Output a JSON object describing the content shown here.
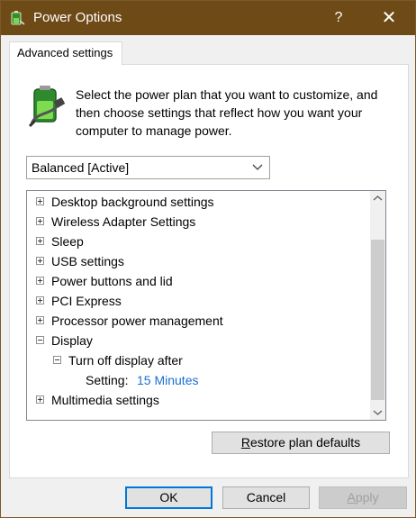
{
  "window": {
    "title": "Power Options",
    "help_glyph": "?",
    "close_glyph": "✕"
  },
  "tab": {
    "label": "Advanced settings"
  },
  "description": "Select the power plan that you want to customize, and then choose settings that reflect how you want your computer to manage power.",
  "plan_select": {
    "value": "Balanced [Active]"
  },
  "tree": {
    "items": [
      {
        "label": "Desktop background settings",
        "expanded": false
      },
      {
        "label": "Wireless Adapter Settings",
        "expanded": false
      },
      {
        "label": "Sleep",
        "expanded": false
      },
      {
        "label": "USB settings",
        "expanded": false
      },
      {
        "label": "Power buttons and lid",
        "expanded": false
      },
      {
        "label": "PCI Express",
        "expanded": false
      },
      {
        "label": "Processor power management",
        "expanded": false
      },
      {
        "label": "Display",
        "expanded": true
      },
      {
        "label": "Turn off display after",
        "expanded": true
      },
      {
        "label": "Setting:",
        "value": "15 Minutes"
      },
      {
        "label": "Multimedia settings",
        "expanded": false
      }
    ]
  },
  "buttons": {
    "restore_first": "R",
    "restore_rest": "estore plan defaults",
    "ok": "OK",
    "cancel": "Cancel",
    "apply_first": "A",
    "apply_rest": "pply"
  },
  "colors": {
    "titlebar": "#6e4a16",
    "link_value": "#1a6fd1",
    "default_button_border": "#0078d7"
  },
  "icons": {
    "app": "power-options-icon",
    "battery": "battery-plug-icon",
    "dropdown": "chevron-down-icon",
    "scroll_up": "chevron-up-icon",
    "scroll_down": "chevron-down-icon"
  }
}
